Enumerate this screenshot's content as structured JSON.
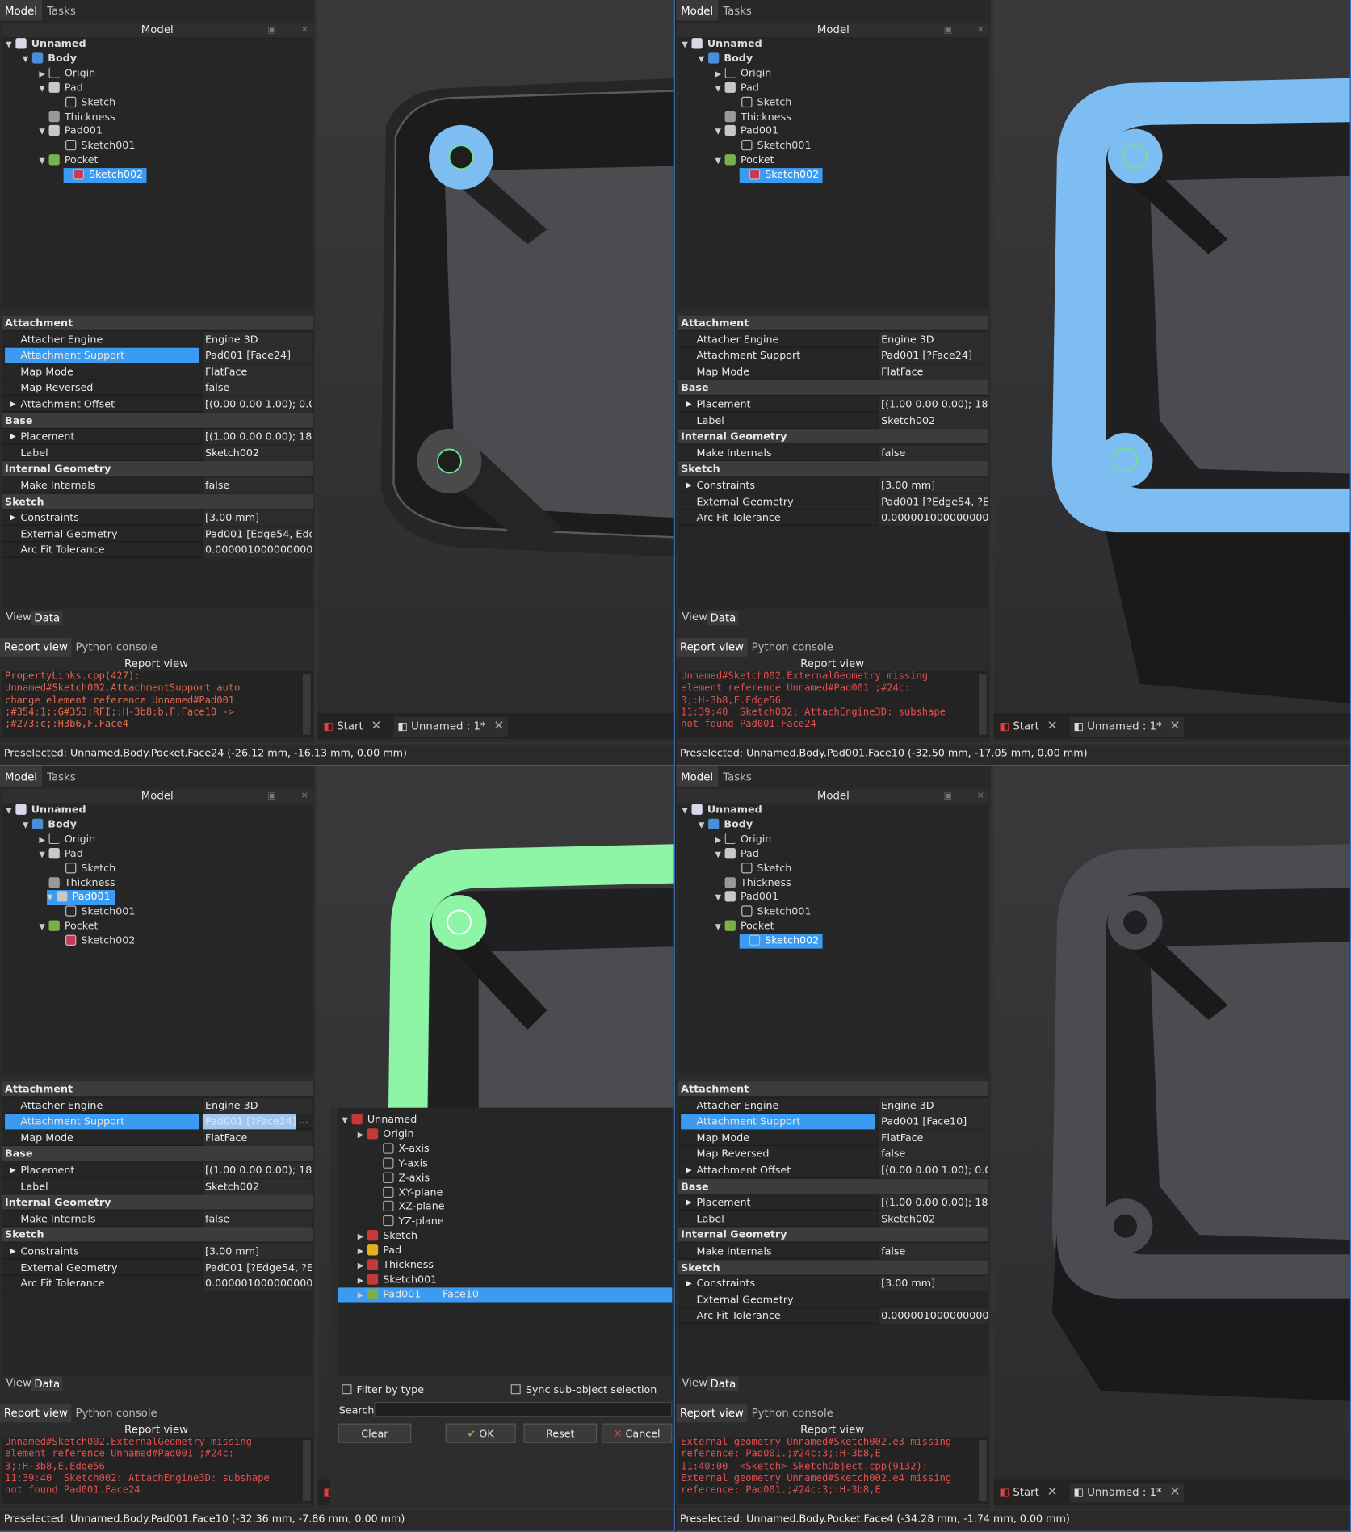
{
  "tabs": {
    "model": "Model",
    "tasks": "Tasks"
  },
  "tree_title": "Model",
  "tree": [
    {
      "label": "Unnamed",
      "level": 0,
      "bold": true,
      "icon": "document-icon"
    },
    {
      "label": "Body",
      "level": 1,
      "bold": true,
      "icon": "body-icon"
    },
    {
      "label": "Origin",
      "level": 2,
      "icon": "origin-icon"
    },
    {
      "label": "Pad",
      "level": 2,
      "icon": "pad-icon"
    },
    {
      "label": "Sketch",
      "level": 3,
      "icon": "sketch-icon"
    },
    {
      "label": "Thickness",
      "level": 2,
      "icon": "thickness-icon"
    },
    {
      "label": "Pad001",
      "level": 2,
      "icon": "pad-icon"
    },
    {
      "label": "Sketch001",
      "level": 3,
      "icon": "sketch-icon"
    },
    {
      "label": "Pocket",
      "level": 2,
      "icon": "pocket-icon"
    },
    {
      "label": "Sketch002",
      "level": 3,
      "icon": "sketch-icon"
    }
  ],
  "groups": {
    "attachment": "Attachment",
    "base": "Base",
    "internal": "Internal Geometry",
    "sketch": "Sketch"
  },
  "labels": {
    "attacher_engine": "Attacher Engine",
    "attachment_support": "Attachment Support",
    "map_mode": "Map Mode",
    "map_reversed": "Map Reversed",
    "attachment_offset": "Attachment Offset",
    "placement": "Placement",
    "label": "Label",
    "make_internals": "Make Internals",
    "constraints": "Constraints",
    "external_geometry": "External Geometry",
    "arc_fit": "Arc Fit Tolerance"
  },
  "values": {
    "engine": "Engine 3D",
    "mode": "FlatFace",
    "reversed": "false",
    "offset": "[(0.00 0.00 1.00); 0.00 ...",
    "placement": "[(1.00 0.00 0.00); 180.0...",
    "label": "Sketch002",
    "internals": "false",
    "constraints": "[3.00 mm]",
    "arc": "0.0000010000000000"
  },
  "q0": {
    "support": "Pad001 [Face24]",
    "ext": "Pad001 [Edge54, Edge...",
    "status": "Preselected: Unnamed.Body.Pocket.Face24 (-26.12 mm, -16.13 mm, 0.00 mm)",
    "report": "PropertyLinks.cpp(427):\nUnnamed#Sketch002.AttachmentSupport auto\nchange element reference Unnamed#Pad001\n;#354:1;:G#353;RFI;:H-3b8:b,F.Face10 ->\n;#273:c;:H3b6,F.Face4"
  },
  "q1": {
    "support": "Pad001 [?Face24]",
    "ext": "Pad001 [?Edge54, ?Edg...",
    "status": "Preselected: Unnamed.Body.Pad001.Face10 (-32.50 mm, -17.05 mm, 0.00 mm)",
    "report": "Unnamed#Sketch002.ExternalGeometry missing\nelement reference Unnamed#Pad001 ;#24c:\n3;:H-3b8,E.Edge56\n11:39:40  Sketch002: AttachEngine3D: subshape\nnot found Pad001.Face24"
  },
  "q2": {
    "support": "Pad001 [?Face24]",
    "ext": "Pad001 [?Edge54, ?Edg...",
    "status": "Preselected: Unnamed.Body.Pad001.Face10 (-32.36 mm, -7.86 mm, 0.00 mm)",
    "report": "Unnamed#Sketch002.ExternalGeometry missing\nelement reference Unnamed#Pad001 ;#24c:\n3;:H-3b8,E.Edge56\n11:39:40  Sketch002: AttachEngine3D: subshape\nnot found Pad001.Face24"
  },
  "q3": {
    "support": "Pad001 [Face10]",
    "ext": "",
    "status": "Preselected: Unnamed.Body.Pocket.Face4 (-34.28 mm, -1.74 mm, 0.00 mm)",
    "report": "External geometry Unnamed#Sketch002.e3 missing\nreference: Pad001.;#24c:3;:H-3b8,E\n11:40:00  <Sketch> SketchObject.cpp(9132):\nExternal geometry Unnamed#Sketch002.e4 missing\nreference: Pad001.;#24c:3;:H-3b8,E"
  },
  "bottom_tabs": {
    "view": "View",
    "data": "Data"
  },
  "report_tabs": {
    "report": "Report view",
    "python": "Python console"
  },
  "report_title": "Report view",
  "doc_tabs": {
    "start": "Start",
    "doc": "Unnamed : 1*"
  },
  "dialog": {
    "items": [
      "Unnamed",
      "Origin",
      "X-axis",
      "Y-axis",
      "Z-axis",
      "XY-plane",
      "XZ-plane",
      "YZ-plane",
      "Sketch",
      "Pad",
      "Thickness",
      "Sketch001",
      "Pad001"
    ],
    "face": "Face10",
    "filter": "Filter by type",
    "sync": "Sync sub-object selection",
    "search": "Search",
    "clear": "Clear",
    "ok": "OK",
    "reset": "Reset",
    "cancel": "Cancel"
  }
}
